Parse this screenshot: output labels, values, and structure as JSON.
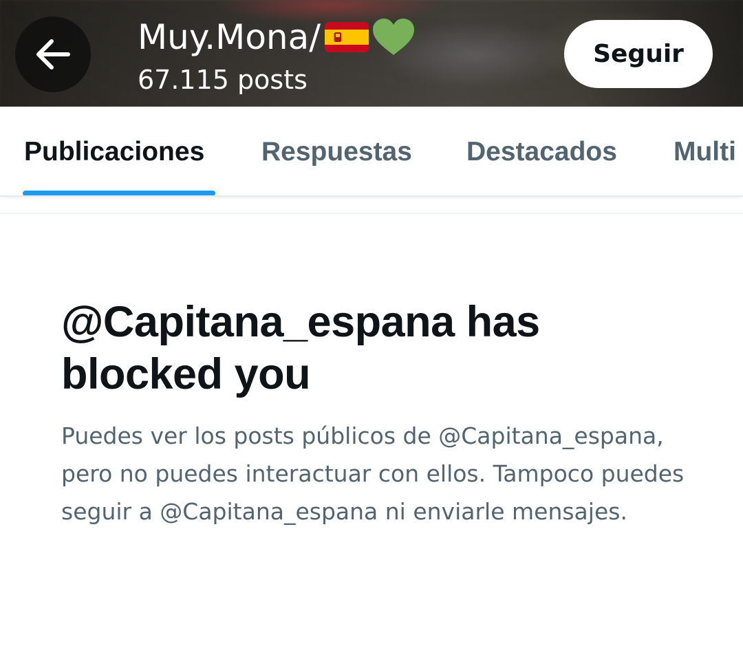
{
  "header": {
    "back_icon": "arrow-left-icon",
    "profile_name": "Muy.Mona/",
    "emojis": [
      "flag-spain-icon",
      "green-heart-icon"
    ],
    "post_count": "67.115 posts",
    "follow_label": "Seguir"
  },
  "tabs": [
    {
      "label": "Publicaciones",
      "active": true
    },
    {
      "label": "Respuestas",
      "active": false
    },
    {
      "label": "Destacados",
      "active": false
    },
    {
      "label": "Multi",
      "active": false
    }
  ],
  "blocked": {
    "title": "@Capitana_espana has blocked you",
    "description": "Puedes ver los posts públicos de @Capitana_espana, pero no puedes interactuar con ellos. Tampoco puedes seguir a @Capitana_espana ni enviarle mensajes."
  },
  "colors": {
    "accent": "#1d9bf0",
    "text_primary": "#0f1419",
    "text_secondary": "#536471",
    "heart": "#78b159",
    "flag_red": "#c60b1e",
    "flag_yellow": "#ffc400"
  }
}
